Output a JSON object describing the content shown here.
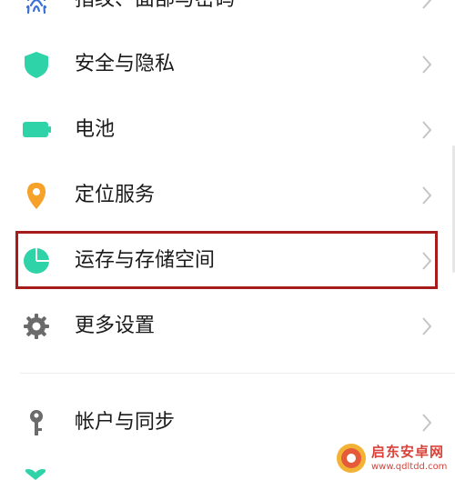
{
  "colors": {
    "accent": "#2ed3a8",
    "location": "#f5a12a",
    "gray_icon": "#6b6b6b",
    "highlight_border": "#a61b1b",
    "chevron": "#c4c4c4",
    "text": "#1a1a1a"
  },
  "settings": {
    "items": [
      {
        "label": "指纹、面部与密码",
        "icon": "fingerprint-icon"
      },
      {
        "label": "安全与隐私",
        "icon": "shield-icon"
      },
      {
        "label": "电池",
        "icon": "battery-icon"
      },
      {
        "label": "定位服务",
        "icon": "location-pin-icon"
      },
      {
        "label": "运存与存储空间",
        "icon": "pie-chart-icon",
        "highlighted": true
      },
      {
        "label": "更多设置",
        "icon": "gear-icon"
      },
      {
        "label": "帐户与同步",
        "icon": "key-icon"
      }
    ]
  },
  "watermark": {
    "brand": "启东安卓网",
    "site": "www.qdltdd.com"
  }
}
